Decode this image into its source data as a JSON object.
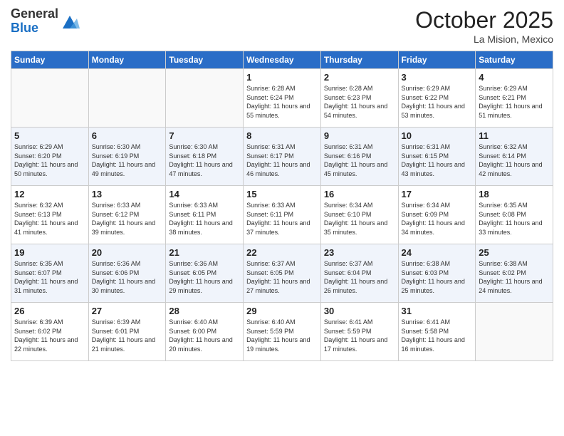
{
  "header": {
    "logo_line1": "General",
    "logo_line2": "Blue",
    "month": "October 2025",
    "location": "La Mision, Mexico"
  },
  "days_of_week": [
    "Sunday",
    "Monday",
    "Tuesday",
    "Wednesday",
    "Thursday",
    "Friday",
    "Saturday"
  ],
  "weeks": [
    [
      {
        "day": "",
        "info": ""
      },
      {
        "day": "",
        "info": ""
      },
      {
        "day": "",
        "info": ""
      },
      {
        "day": "1",
        "info": "Sunrise: 6:28 AM\nSunset: 6:24 PM\nDaylight: 11 hours\nand 55 minutes."
      },
      {
        "day": "2",
        "info": "Sunrise: 6:28 AM\nSunset: 6:23 PM\nDaylight: 11 hours\nand 54 minutes."
      },
      {
        "day": "3",
        "info": "Sunrise: 6:29 AM\nSunset: 6:22 PM\nDaylight: 11 hours\nand 53 minutes."
      },
      {
        "day": "4",
        "info": "Sunrise: 6:29 AM\nSunset: 6:21 PM\nDaylight: 11 hours\nand 51 minutes."
      }
    ],
    [
      {
        "day": "5",
        "info": "Sunrise: 6:29 AM\nSunset: 6:20 PM\nDaylight: 11 hours\nand 50 minutes."
      },
      {
        "day": "6",
        "info": "Sunrise: 6:30 AM\nSunset: 6:19 PM\nDaylight: 11 hours\nand 49 minutes."
      },
      {
        "day": "7",
        "info": "Sunrise: 6:30 AM\nSunset: 6:18 PM\nDaylight: 11 hours\nand 47 minutes."
      },
      {
        "day": "8",
        "info": "Sunrise: 6:31 AM\nSunset: 6:17 PM\nDaylight: 11 hours\nand 46 minutes."
      },
      {
        "day": "9",
        "info": "Sunrise: 6:31 AM\nSunset: 6:16 PM\nDaylight: 11 hours\nand 45 minutes."
      },
      {
        "day": "10",
        "info": "Sunrise: 6:31 AM\nSunset: 6:15 PM\nDaylight: 11 hours\nand 43 minutes."
      },
      {
        "day": "11",
        "info": "Sunrise: 6:32 AM\nSunset: 6:14 PM\nDaylight: 11 hours\nand 42 minutes."
      }
    ],
    [
      {
        "day": "12",
        "info": "Sunrise: 6:32 AM\nSunset: 6:13 PM\nDaylight: 11 hours\nand 41 minutes."
      },
      {
        "day": "13",
        "info": "Sunrise: 6:33 AM\nSunset: 6:12 PM\nDaylight: 11 hours\nand 39 minutes."
      },
      {
        "day": "14",
        "info": "Sunrise: 6:33 AM\nSunset: 6:11 PM\nDaylight: 11 hours\nand 38 minutes."
      },
      {
        "day": "15",
        "info": "Sunrise: 6:33 AM\nSunset: 6:11 PM\nDaylight: 11 hours\nand 37 minutes."
      },
      {
        "day": "16",
        "info": "Sunrise: 6:34 AM\nSunset: 6:10 PM\nDaylight: 11 hours\nand 35 minutes."
      },
      {
        "day": "17",
        "info": "Sunrise: 6:34 AM\nSunset: 6:09 PM\nDaylight: 11 hours\nand 34 minutes."
      },
      {
        "day": "18",
        "info": "Sunrise: 6:35 AM\nSunset: 6:08 PM\nDaylight: 11 hours\nand 33 minutes."
      }
    ],
    [
      {
        "day": "19",
        "info": "Sunrise: 6:35 AM\nSunset: 6:07 PM\nDaylight: 11 hours\nand 31 minutes."
      },
      {
        "day": "20",
        "info": "Sunrise: 6:36 AM\nSunset: 6:06 PM\nDaylight: 11 hours\nand 30 minutes."
      },
      {
        "day": "21",
        "info": "Sunrise: 6:36 AM\nSunset: 6:05 PM\nDaylight: 11 hours\nand 29 minutes."
      },
      {
        "day": "22",
        "info": "Sunrise: 6:37 AM\nSunset: 6:05 PM\nDaylight: 11 hours\nand 27 minutes."
      },
      {
        "day": "23",
        "info": "Sunrise: 6:37 AM\nSunset: 6:04 PM\nDaylight: 11 hours\nand 26 minutes."
      },
      {
        "day": "24",
        "info": "Sunrise: 6:38 AM\nSunset: 6:03 PM\nDaylight: 11 hours\nand 25 minutes."
      },
      {
        "day": "25",
        "info": "Sunrise: 6:38 AM\nSunset: 6:02 PM\nDaylight: 11 hours\nand 24 minutes."
      }
    ],
    [
      {
        "day": "26",
        "info": "Sunrise: 6:39 AM\nSunset: 6:02 PM\nDaylight: 11 hours\nand 22 minutes."
      },
      {
        "day": "27",
        "info": "Sunrise: 6:39 AM\nSunset: 6:01 PM\nDaylight: 11 hours\nand 21 minutes."
      },
      {
        "day": "28",
        "info": "Sunrise: 6:40 AM\nSunset: 6:00 PM\nDaylight: 11 hours\nand 20 minutes."
      },
      {
        "day": "29",
        "info": "Sunrise: 6:40 AM\nSunset: 5:59 PM\nDaylight: 11 hours\nand 19 minutes."
      },
      {
        "day": "30",
        "info": "Sunrise: 6:41 AM\nSunset: 5:59 PM\nDaylight: 11 hours\nand 17 minutes."
      },
      {
        "day": "31",
        "info": "Sunrise: 6:41 AM\nSunset: 5:58 PM\nDaylight: 11 hours\nand 16 minutes."
      },
      {
        "day": "",
        "info": ""
      }
    ]
  ]
}
